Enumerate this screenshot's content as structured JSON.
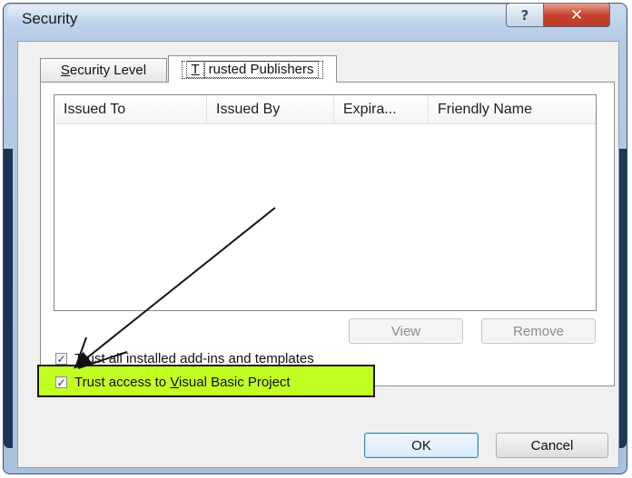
{
  "window": {
    "title": "Security",
    "help_button": "?",
    "close_button": "✕"
  },
  "tabs": [
    {
      "label_prefix": "",
      "label_accel": "S",
      "label_rest": "ecurity Level",
      "selected": false
    },
    {
      "label_prefix": "",
      "label_accel": "T",
      "label_rest": "rusted Publishers",
      "selected": true
    }
  ],
  "table": {
    "columns": [
      "Issued To",
      "Issued By",
      "Expira...",
      "Friendly Name"
    ],
    "rows": []
  },
  "buttons": {
    "view": "View",
    "remove": "Remove",
    "ok": "OK",
    "cancel": "Cancel"
  },
  "options": {
    "trust_addins": {
      "label": "Trust all installed add-ins and templates",
      "checked": true
    },
    "trust_vba": {
      "label_prefix": "Trust access to ",
      "label_accel": "V",
      "label_rest": "isual Basic Project",
      "checked": true
    }
  },
  "icons": {
    "checkmark": "✓",
    "help": "question-mark-icon",
    "close": "close-icon"
  },
  "colors": {
    "highlight": "#c2ff22",
    "close_button": "#c5432f",
    "title_bar": "#b5cbe6"
  }
}
